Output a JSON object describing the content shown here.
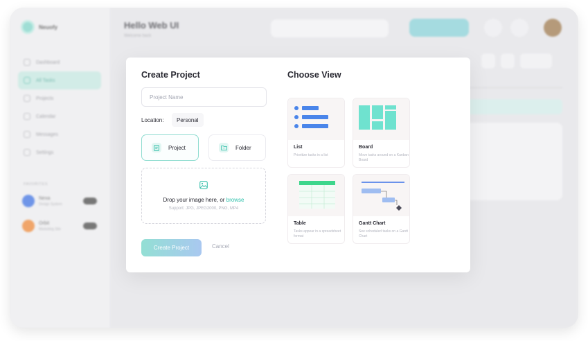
{
  "app": {
    "name": "Neuofy",
    "greeting": "Hello Web UI",
    "greeting_sub": "Welcome back",
    "search_placeholder": "Search anything",
    "add_button": "Add Project",
    "share_label": "Share",
    "nav": [
      "Dashboard",
      "All Tasks",
      "Projects",
      "Calendar",
      "Messages",
      "Settings"
    ],
    "favorites_title": "FAVORITES",
    "favorites": [
      {
        "name": "Nexa",
        "sub": "Design System",
        "color": "#6f95e8"
      },
      {
        "name": "Orbit",
        "sub": "Marketing Site",
        "color": "#f0a56a"
      }
    ]
  },
  "modal": {
    "title": "Create Project",
    "name_placeholder": "Project Name",
    "location_label": "Location:",
    "location_value": "Personal",
    "type_project": "Project",
    "type_folder": "Folder",
    "drop_text": "Drop your image here, or ",
    "drop_browse": "browse",
    "drop_support": "Support: JPG, JPEG2000, PNG, MP4",
    "create_button": "Create Project",
    "cancel_button": "Cancel"
  },
  "views": {
    "title": "Choose View",
    "items": [
      {
        "name": "List",
        "desc": "Prioritize tasks in a list"
      },
      {
        "name": "Board",
        "desc": "Move tasks around on a Kanban Board"
      },
      {
        "name": "Table",
        "desc": "Tasks appear in a spreadsheet format"
      },
      {
        "name": "Gantt Chart",
        "desc": "See scheduled tasks on a Gantt Chart"
      }
    ]
  },
  "colors": {
    "accent": "#2fc1ac",
    "teal_block": "#6fe2cf",
    "blue_bar": "#4a85ea",
    "green_header": "#3dd68c"
  }
}
